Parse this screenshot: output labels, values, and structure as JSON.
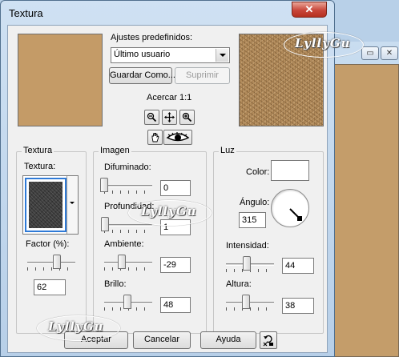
{
  "window": {
    "title": "Textura",
    "close_glyph": "✕"
  },
  "background_window": {
    "restore_glyph": "▭",
    "close_glyph": "✕"
  },
  "presets": {
    "label": "Ajustes predefinidos:",
    "selected": "Último usuario",
    "save_as_label": "Guardar Como...",
    "delete_label": "Suprimir"
  },
  "zoom": {
    "label": "Acercar 1:1"
  },
  "textura_group": {
    "legend": "Textura",
    "texture_label": "Textura:",
    "factor_label": "Factor (%):",
    "factor_value": "62",
    "factor_slider": 0.62
  },
  "imagen_group": {
    "legend": "Imagen",
    "difuminado_label": "Difuminado:",
    "difuminado_value": "0",
    "difuminado_slider": 0.0,
    "profundidad_label": "Profundidad:",
    "profundidad_value": "1",
    "profundidad_slider": 0.02,
    "ambiente_label": "Ambiente:",
    "ambiente_value": "-29",
    "ambiente_slider": 0.36,
    "brillo_label": "Brillo:",
    "brillo_value": "48",
    "brillo_slider": 0.48
  },
  "luz_group": {
    "legend": "Luz",
    "color_label": "Color:",
    "color_value": "#ffffff",
    "angulo_label": "Ángulo:",
    "angulo_value": "315",
    "intensidad_label": "Intensidad:",
    "intensidad_value": "44",
    "intensidad_slider": 0.44,
    "altura_label": "Altura:",
    "altura_value": "38",
    "altura_slider": 0.42
  },
  "footer": {
    "ok_label": "Aceptar",
    "cancel_label": "Cancelar",
    "help_label": "Ayuda"
  },
  "watermark": {
    "text": "LyllyGu"
  },
  "colors": {
    "preview_original": "#c49b67",
    "preview_result": "#b38c5c",
    "background_canvas": "#c49d6a",
    "title_close_red": "#c8463a"
  }
}
